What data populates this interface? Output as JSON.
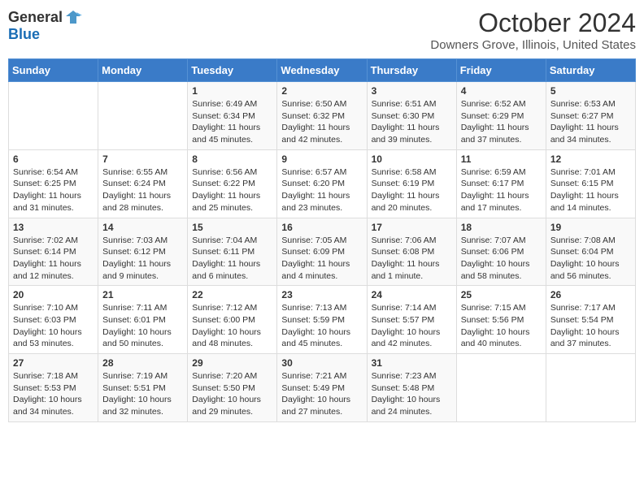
{
  "header": {
    "logo_general": "General",
    "logo_blue": "Blue",
    "month_title": "October 2024",
    "location": "Downers Grove, Illinois, United States"
  },
  "days_of_week": [
    "Sunday",
    "Monday",
    "Tuesday",
    "Wednesday",
    "Thursday",
    "Friday",
    "Saturday"
  ],
  "weeks": [
    [
      {
        "day": "",
        "content": ""
      },
      {
        "day": "",
        "content": ""
      },
      {
        "day": "1",
        "content": "Sunrise: 6:49 AM\nSunset: 6:34 PM\nDaylight: 11 hours and 45 minutes."
      },
      {
        "day": "2",
        "content": "Sunrise: 6:50 AM\nSunset: 6:32 PM\nDaylight: 11 hours and 42 minutes."
      },
      {
        "day": "3",
        "content": "Sunrise: 6:51 AM\nSunset: 6:30 PM\nDaylight: 11 hours and 39 minutes."
      },
      {
        "day": "4",
        "content": "Sunrise: 6:52 AM\nSunset: 6:29 PM\nDaylight: 11 hours and 37 minutes."
      },
      {
        "day": "5",
        "content": "Sunrise: 6:53 AM\nSunset: 6:27 PM\nDaylight: 11 hours and 34 minutes."
      }
    ],
    [
      {
        "day": "6",
        "content": "Sunrise: 6:54 AM\nSunset: 6:25 PM\nDaylight: 11 hours and 31 minutes."
      },
      {
        "day": "7",
        "content": "Sunrise: 6:55 AM\nSunset: 6:24 PM\nDaylight: 11 hours and 28 minutes."
      },
      {
        "day": "8",
        "content": "Sunrise: 6:56 AM\nSunset: 6:22 PM\nDaylight: 11 hours and 25 minutes."
      },
      {
        "day": "9",
        "content": "Sunrise: 6:57 AM\nSunset: 6:20 PM\nDaylight: 11 hours and 23 minutes."
      },
      {
        "day": "10",
        "content": "Sunrise: 6:58 AM\nSunset: 6:19 PM\nDaylight: 11 hours and 20 minutes."
      },
      {
        "day": "11",
        "content": "Sunrise: 6:59 AM\nSunset: 6:17 PM\nDaylight: 11 hours and 17 minutes."
      },
      {
        "day": "12",
        "content": "Sunrise: 7:01 AM\nSunset: 6:15 PM\nDaylight: 11 hours and 14 minutes."
      }
    ],
    [
      {
        "day": "13",
        "content": "Sunrise: 7:02 AM\nSunset: 6:14 PM\nDaylight: 11 hours and 12 minutes."
      },
      {
        "day": "14",
        "content": "Sunrise: 7:03 AM\nSunset: 6:12 PM\nDaylight: 11 hours and 9 minutes."
      },
      {
        "day": "15",
        "content": "Sunrise: 7:04 AM\nSunset: 6:11 PM\nDaylight: 11 hours and 6 minutes."
      },
      {
        "day": "16",
        "content": "Sunrise: 7:05 AM\nSunset: 6:09 PM\nDaylight: 11 hours and 4 minutes."
      },
      {
        "day": "17",
        "content": "Sunrise: 7:06 AM\nSunset: 6:08 PM\nDaylight: 11 hours and 1 minute."
      },
      {
        "day": "18",
        "content": "Sunrise: 7:07 AM\nSunset: 6:06 PM\nDaylight: 10 hours and 58 minutes."
      },
      {
        "day": "19",
        "content": "Sunrise: 7:08 AM\nSunset: 6:04 PM\nDaylight: 10 hours and 56 minutes."
      }
    ],
    [
      {
        "day": "20",
        "content": "Sunrise: 7:10 AM\nSunset: 6:03 PM\nDaylight: 10 hours and 53 minutes."
      },
      {
        "day": "21",
        "content": "Sunrise: 7:11 AM\nSunset: 6:01 PM\nDaylight: 10 hours and 50 minutes."
      },
      {
        "day": "22",
        "content": "Sunrise: 7:12 AM\nSunset: 6:00 PM\nDaylight: 10 hours and 48 minutes."
      },
      {
        "day": "23",
        "content": "Sunrise: 7:13 AM\nSunset: 5:59 PM\nDaylight: 10 hours and 45 minutes."
      },
      {
        "day": "24",
        "content": "Sunrise: 7:14 AM\nSunset: 5:57 PM\nDaylight: 10 hours and 42 minutes."
      },
      {
        "day": "25",
        "content": "Sunrise: 7:15 AM\nSunset: 5:56 PM\nDaylight: 10 hours and 40 minutes."
      },
      {
        "day": "26",
        "content": "Sunrise: 7:17 AM\nSunset: 5:54 PM\nDaylight: 10 hours and 37 minutes."
      }
    ],
    [
      {
        "day": "27",
        "content": "Sunrise: 7:18 AM\nSunset: 5:53 PM\nDaylight: 10 hours and 34 minutes."
      },
      {
        "day": "28",
        "content": "Sunrise: 7:19 AM\nSunset: 5:51 PM\nDaylight: 10 hours and 32 minutes."
      },
      {
        "day": "29",
        "content": "Sunrise: 7:20 AM\nSunset: 5:50 PM\nDaylight: 10 hours and 29 minutes."
      },
      {
        "day": "30",
        "content": "Sunrise: 7:21 AM\nSunset: 5:49 PM\nDaylight: 10 hours and 27 minutes."
      },
      {
        "day": "31",
        "content": "Sunrise: 7:23 AM\nSunset: 5:48 PM\nDaylight: 10 hours and 24 minutes."
      },
      {
        "day": "",
        "content": ""
      },
      {
        "day": "",
        "content": ""
      }
    ]
  ]
}
